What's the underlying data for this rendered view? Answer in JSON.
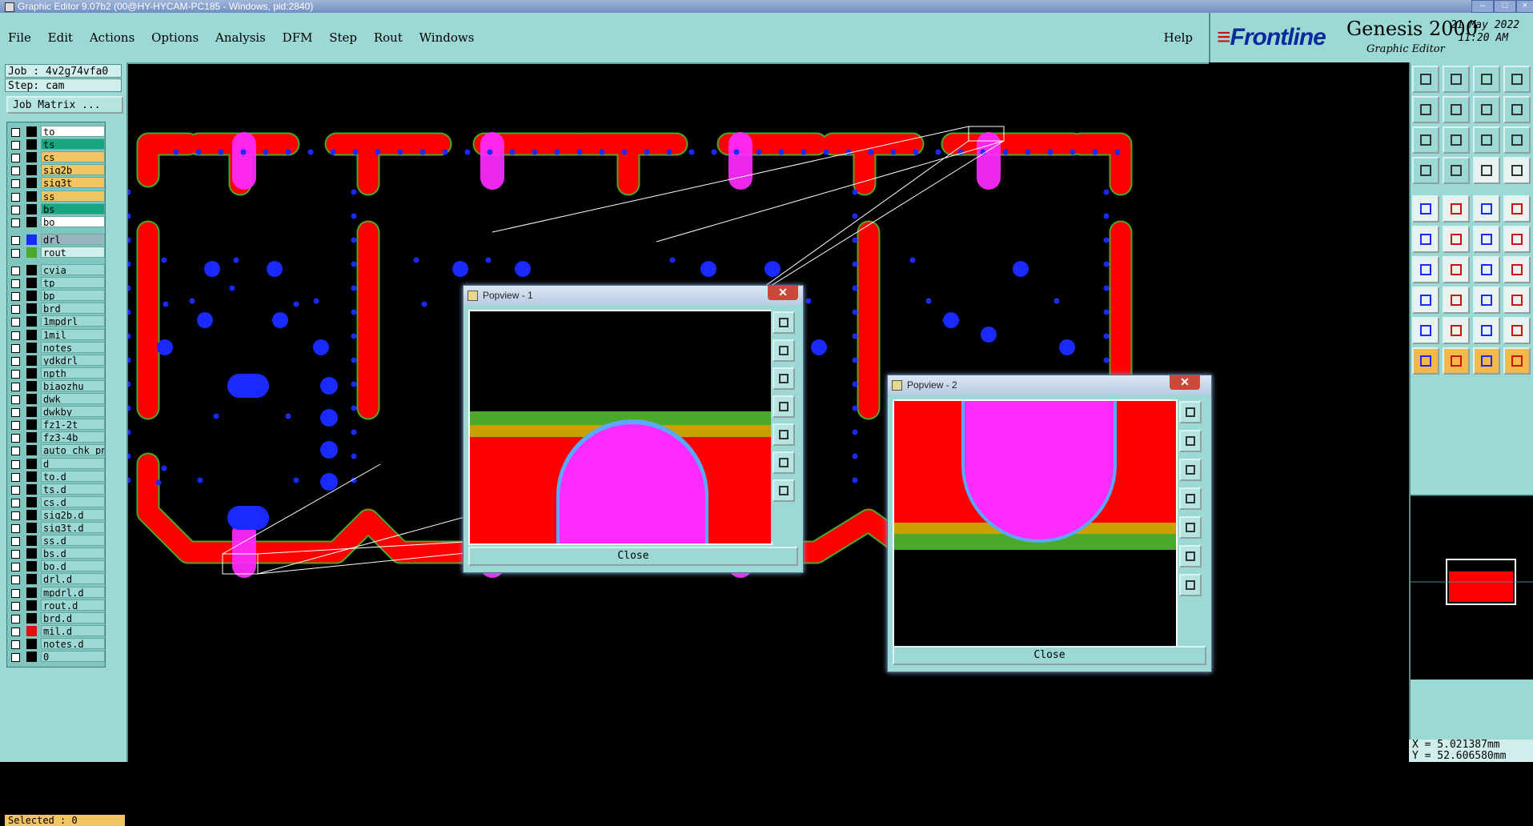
{
  "window": {
    "title": "Graphic Editor 9.07b2 (00@HY-HYCAM-PC185 - Windows, pid:2840)"
  },
  "menu": {
    "items": [
      "File",
      "Edit",
      "Actions",
      "Options",
      "Analysis",
      "DFM",
      "Step",
      "Rout",
      "Windows"
    ],
    "help": "Help"
  },
  "brand": {
    "logo": "Frontline",
    "product": "Genesis 2000",
    "subtitle": "Graphic Editor",
    "date": "21 May 2022",
    "time": "11:20 AM"
  },
  "job": {
    "job_line": "Job : 4v2g74vfa0",
    "step_line": "Step: cam",
    "matrix_button": "Job Matrix ..."
  },
  "layers": [
    {
      "name": "to",
      "bg": "#ffffff",
      "swatch": "#000000"
    },
    {
      "name": "ts",
      "bg": "#1aa582",
      "swatch": "#000000"
    },
    {
      "name": "cs",
      "bg": "#f2c462",
      "swatch": "#000000"
    },
    {
      "name": "sig2b",
      "bg": "#f2c462",
      "swatch": "#000000"
    },
    {
      "name": "sig3t",
      "bg": "#f2c462",
      "swatch": "#000000"
    },
    {
      "name": "ss",
      "bg": "#f2c462",
      "swatch": "#000000"
    },
    {
      "name": "bs",
      "bg": "#1aa582",
      "swatch": "#000000"
    },
    {
      "name": "bo",
      "bg": "#ffffff",
      "swatch": "#000000"
    },
    {
      "name": "drl",
      "bg": "#9ab5c0",
      "swatch": "#1a2aff"
    },
    {
      "name": "rout",
      "bg": "#cfeeec",
      "swatch": "#4aa82a"
    },
    {
      "name": "cvia",
      "bg": "#9cd8d4",
      "swatch": "#000000"
    },
    {
      "name": "tp",
      "bg": "#9cd8d4",
      "swatch": "#000000"
    },
    {
      "name": "bp",
      "bg": "#9cd8d4",
      "swatch": "#000000"
    },
    {
      "name": "brd",
      "bg": "#9cd8d4",
      "swatch": "#000000"
    },
    {
      "name": "1mpdrl",
      "bg": "#9cd8d4",
      "swatch": "#000000"
    },
    {
      "name": "1mil",
      "bg": "#9cd8d4",
      "swatch": "#000000"
    },
    {
      "name": "notes",
      "bg": "#9cd8d4",
      "swatch": "#000000"
    },
    {
      "name": "ydkdrl",
      "bg": "#9cd8d4",
      "swatch": "#000000"
    },
    {
      "name": "npth",
      "bg": "#9cd8d4",
      "swatch": "#000000"
    },
    {
      "name": "biaozhu",
      "bg": "#9cd8d4",
      "swatch": "#000000"
    },
    {
      "name": "dwk",
      "bg": "#9cd8d4",
      "swatch": "#000000"
    },
    {
      "name": "dwkby",
      "bg": "#9cd8d4",
      "swatch": "#000000"
    },
    {
      "name": "fz1-2t",
      "bg": "#9cd8d4",
      "swatch": "#000000"
    },
    {
      "name": "fz3-4b",
      "bg": "#9cd8d4",
      "swatch": "#000000"
    },
    {
      "name": "auto_chk_pn",
      "bg": "#9cd8d4",
      "swatch": "#000000"
    },
    {
      "name": "d",
      "bg": "#9cd8d4",
      "swatch": "#000000"
    },
    {
      "name": "to.d",
      "bg": "#9cd8d4",
      "swatch": "#000000"
    },
    {
      "name": "ts.d",
      "bg": "#9cd8d4",
      "swatch": "#000000"
    },
    {
      "name": "cs.d",
      "bg": "#9cd8d4",
      "swatch": "#000000"
    },
    {
      "name": "sig2b.d",
      "bg": "#9cd8d4",
      "swatch": "#000000"
    },
    {
      "name": "sig3t.d",
      "bg": "#9cd8d4",
      "swatch": "#000000"
    },
    {
      "name": "ss.d",
      "bg": "#9cd8d4",
      "swatch": "#000000"
    },
    {
      "name": "bs.d",
      "bg": "#9cd8d4",
      "swatch": "#000000"
    },
    {
      "name": "bo.d",
      "bg": "#9cd8d4",
      "swatch": "#000000"
    },
    {
      "name": "drl.d",
      "bg": "#9cd8d4",
      "swatch": "#000000"
    },
    {
      "name": "mpdrl.d",
      "bg": "#9cd8d4",
      "swatch": "#000000"
    },
    {
      "name": "rout.d",
      "bg": "#9cd8d4",
      "swatch": "#000000"
    },
    {
      "name": "brd.d",
      "bg": "#9cd8d4",
      "swatch": "#000000"
    },
    {
      "name": "mil.d",
      "bg": "#9cd8d4",
      "swatch": "#e01010"
    },
    {
      "name": "notes.d",
      "bg": "#9cd8d4",
      "swatch": "#000000"
    },
    {
      "name": "0",
      "bg": "#9cd8d4",
      "swatch": "#000000"
    }
  ],
  "status": {
    "selected": "Selected : 0"
  },
  "coords": {
    "x": "X =  5.021387mm",
    "y": "Y = 52.606580mm"
  },
  "popview1": {
    "title": "Popview - 1",
    "close": "Close"
  },
  "popview2": {
    "title": "Popview - 2",
    "close": "Close"
  },
  "colors": {
    "panel": "#9cd8d4",
    "copper": "#ff0000",
    "outline": "#4aa82a",
    "highlight": "#ff2aff",
    "drill": "#1a2aff"
  }
}
